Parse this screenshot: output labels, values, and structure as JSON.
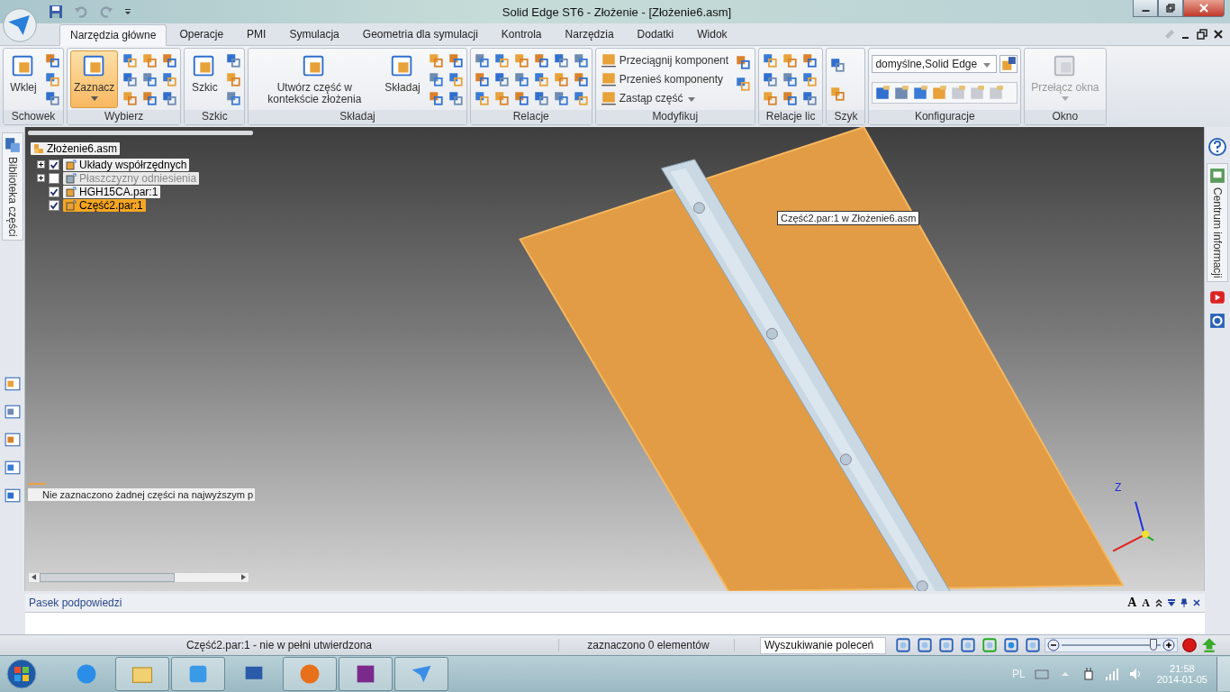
{
  "window": {
    "title": "Solid Edge ST6 - Złożenie - [Złożenie6.asm]"
  },
  "tabs": [
    {
      "label": "Narzędzia główne",
      "selected": true
    },
    {
      "label": "Operacje",
      "selected": false
    },
    {
      "label": "PMI",
      "selected": false
    },
    {
      "label": "Symulacja",
      "selected": false
    },
    {
      "label": "Geometria dla symulacji",
      "selected": false
    },
    {
      "label": "Kontrola",
      "selected": false
    },
    {
      "label": "Narzędzia",
      "selected": false
    },
    {
      "label": "Dodatki",
      "selected": false
    },
    {
      "label": "Widok",
      "selected": false
    }
  ],
  "ribbon": [
    {
      "label": "Schowek",
      "buttons": [
        {
          "kind": "large",
          "label": "Wklej",
          "selected": false,
          "disabled": false,
          "dropdown": false
        }
      ]
    },
    {
      "label": "Wybierz",
      "buttons": [
        {
          "kind": "large",
          "label": "Zaznacz",
          "selected": true,
          "disabled": false,
          "dropdown": true
        }
      ]
    },
    {
      "label": "Szkic",
      "buttons": [
        {
          "kind": "large",
          "label": "Szkic",
          "selected": false,
          "disabled": false,
          "dropdown": false
        }
      ]
    },
    {
      "label": "Składaj",
      "buttons": [
        {
          "kind": "large",
          "label": "Utwórz część w kontekście złożenia",
          "selected": false,
          "disabled": false,
          "dropdown": false
        },
        {
          "kind": "large",
          "label": "Składaj",
          "selected": false,
          "disabled": false,
          "dropdown": false
        }
      ]
    },
    {
      "label": "Relacje"
    },
    {
      "label": "Modyfikuj",
      "buttons": [
        {
          "kind": "row",
          "label": "Przeciągnij komponent",
          "dropdown": false
        },
        {
          "kind": "row",
          "label": "Przenieś komponenty",
          "dropdown": false
        },
        {
          "kind": "row",
          "label": "Zastąp część",
          "dropdown": true
        }
      ]
    },
    {
      "label": "Relacje lic"
    },
    {
      "label": "Szyk"
    },
    {
      "label": "Konfiguracje",
      "buttons": [
        {
          "kind": "combo",
          "value": "domyślne,Solid Edge"
        }
      ]
    },
    {
      "label": "Okno",
      "buttons": [
        {
          "kind": "large",
          "label": "Przełącz okna",
          "selected": false,
          "disabled": true,
          "dropdown": true
        }
      ]
    }
  ],
  "side_left": {
    "label": "Biblioteka części"
  },
  "side_right": {
    "label": "Centrum informacji"
  },
  "tree": {
    "root": {
      "label": "Złożenie6.asm",
      "children": [
        {
          "label": "Układy współrzędnych",
          "checked": true,
          "expanded": false,
          "disabled": false,
          "selected": false
        },
        {
          "label": "Płaszczyzny odniesienia",
          "checked": false,
          "expanded": false,
          "disabled": true,
          "selected": false
        },
        {
          "label": "HGH15CA.par:1",
          "checked": true,
          "disabled": false,
          "selected": false
        },
        {
          "label": "Część2.par:1",
          "checked": true,
          "disabled": false,
          "selected": true
        }
      ]
    },
    "message": "Nie zaznaczono żadnej części na najwyższym p"
  },
  "tooltip": "Część2.par:1 w Złożenie6.asm",
  "axis": {
    "z": "Z"
  },
  "hint_bar": {
    "title": "Pasek podpowiedzi",
    "font_buttons": [
      "A",
      "A"
    ]
  },
  "status_bar": {
    "message": "Część2.par:1 - nie w pełni utwierdzona",
    "selection": "zaznaczono 0 elementów",
    "search": {
      "placeholder": "Wyszukiwanie poleceń"
    },
    "zoom": {
      "level": 0.93
    }
  },
  "taskbar": {
    "language": "PL",
    "time": "21:58",
    "date": "2014-01-05"
  }
}
